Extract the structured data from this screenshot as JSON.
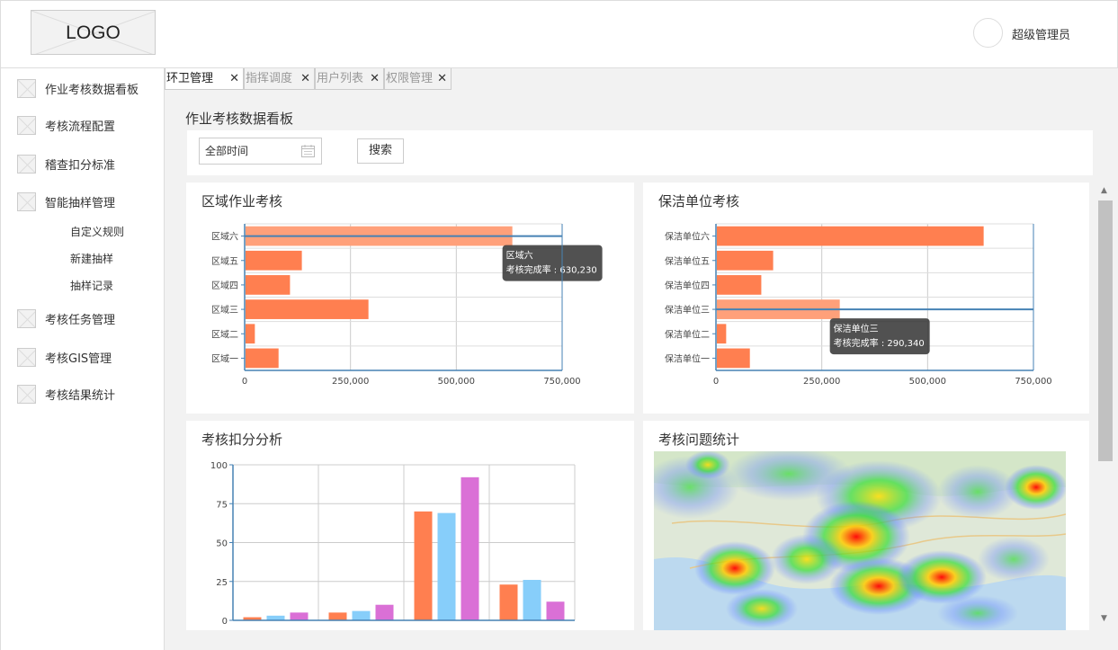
{
  "header": {
    "logo": "LOGO",
    "username": "超级管理员"
  },
  "sidebar": {
    "items": [
      {
        "label": "作业考核数据看板"
      },
      {
        "label": "考核流程配置"
      },
      {
        "label": "稽查扣分标准"
      },
      {
        "label": "智能抽样管理"
      },
      {
        "label": "考核任务管理"
      },
      {
        "label": "考核GIS管理"
      },
      {
        "label": "考核结果统计"
      }
    ],
    "subitems": [
      {
        "label": "自定义规则"
      },
      {
        "label": "新建抽样"
      },
      {
        "label": "抽样记录"
      }
    ]
  },
  "tabs": [
    {
      "label": "环卫管理",
      "active": true
    },
    {
      "label": "指挥调度",
      "active": false
    },
    {
      "label": "用户列表",
      "active": false
    },
    {
      "label": "权限管理",
      "active": false
    }
  ],
  "page": {
    "title": "作业考核数据看板"
  },
  "filter": {
    "date_value": "全部时间",
    "search_label": "搜索"
  },
  "cards": {
    "region": "区域作业考核",
    "unit": "保洁单位考核",
    "deduction": "考核扣分分析",
    "issues": "考核问题统计"
  },
  "colors": {
    "bar": "#ff7f50",
    "bar_highlight": "#ffa07a",
    "axis": "#4682b4",
    "blue": "#87cefa",
    "purple": "#da70d6"
  },
  "chart_data": [
    {
      "type": "bar",
      "orientation": "horizontal",
      "title": "区域作业考核",
      "categories": [
        "区域一",
        "区域二",
        "区域三",
        "区域四",
        "区域五",
        "区域六"
      ],
      "values": [
        78000,
        22000,
        290340,
        105000,
        133000,
        630230
      ],
      "xlim": [
        0,
        750000
      ],
      "xticks": [
        "0",
        "250,000",
        "500,000",
        "750,000"
      ],
      "grid": true,
      "tooltip": {
        "category": "区域六",
        "label": "考核完成率",
        "value": "630,230"
      }
    },
    {
      "type": "bar",
      "orientation": "horizontal",
      "title": "保洁单位考核",
      "categories": [
        "保洁单位一",
        "保洁单位二",
        "保洁单位三",
        "保洁单位四",
        "保洁单位五",
        "保洁单位六"
      ],
      "values": [
        78000,
        22000,
        290340,
        105000,
        133000,
        630230
      ],
      "xlim": [
        0,
        750000
      ],
      "xticks": [
        "0",
        "250,000",
        "500,000",
        "750,000"
      ],
      "grid": true,
      "tooltip": {
        "category": "保洁单位三",
        "label": "考核完成率",
        "value": "290,340"
      }
    },
    {
      "type": "bar",
      "title": "考核扣分分析",
      "categories": [
        "",
        "",
        "",
        ""
      ],
      "series": [
        {
          "values": [
            2,
            5,
            70,
            23
          ]
        },
        {
          "values": [
            3,
            6,
            69,
            26
          ]
        },
        {
          "values": [
            5,
            10,
            92,
            12
          ]
        }
      ],
      "ylim": [
        0,
        100
      ],
      "yticks": [
        "0",
        "25",
        "50",
        "75",
        "100"
      ],
      "grid": true
    }
  ]
}
